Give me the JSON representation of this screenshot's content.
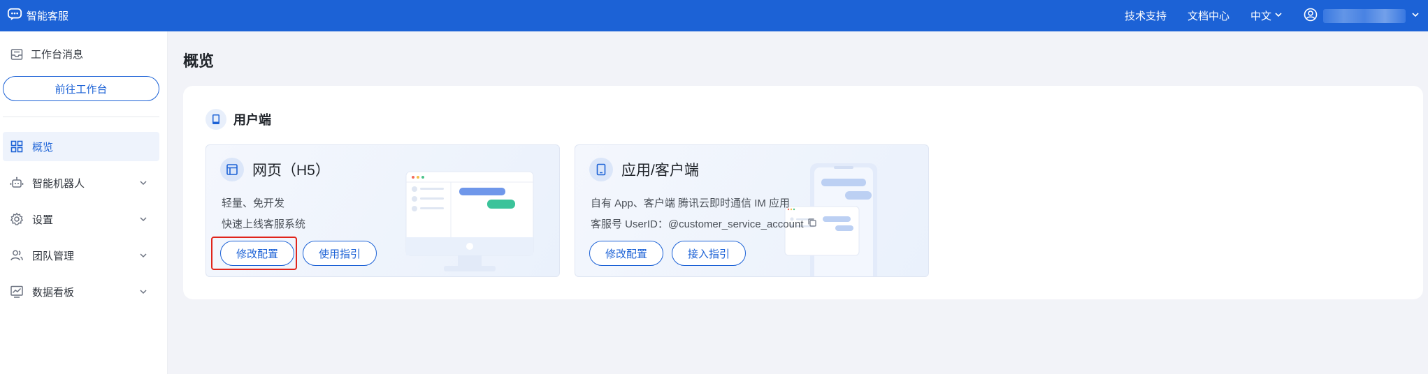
{
  "topbar": {
    "brand": "智能客服",
    "links": [
      "技术支持",
      "文档中心"
    ],
    "language": "中文"
  },
  "sidebar": {
    "message_label": "工作台消息",
    "workbench_button": "前往工作台",
    "items": [
      {
        "label": "概览",
        "active": true,
        "icon": "grid-icon"
      },
      {
        "label": "智能机器人",
        "icon": "robot-icon"
      },
      {
        "label": "设置",
        "icon": "gear-icon"
      },
      {
        "label": "团队管理",
        "icon": "team-icon"
      },
      {
        "label": "数据看板",
        "icon": "chart-icon"
      }
    ]
  },
  "main": {
    "title": "概览",
    "section_title": "用户端",
    "cards": [
      {
        "title": "网页（H5）",
        "lines": [
          "轻量、免开发",
          "快速上线客服系统"
        ],
        "buttons": [
          "修改配置",
          "使用指引"
        ]
      },
      {
        "title": "应用/客户端",
        "lines": [
          "自有 App、客户端   腾讯云即时通信 IM 应用",
          "客服号 UserID：@customer_service_account"
        ],
        "buttons": [
          "修改配置",
          "接入指引"
        ]
      }
    ]
  },
  "colors": {
    "brand": "#1c62d6",
    "highlight": "#e0241b",
    "background": "#f2f3f8"
  }
}
